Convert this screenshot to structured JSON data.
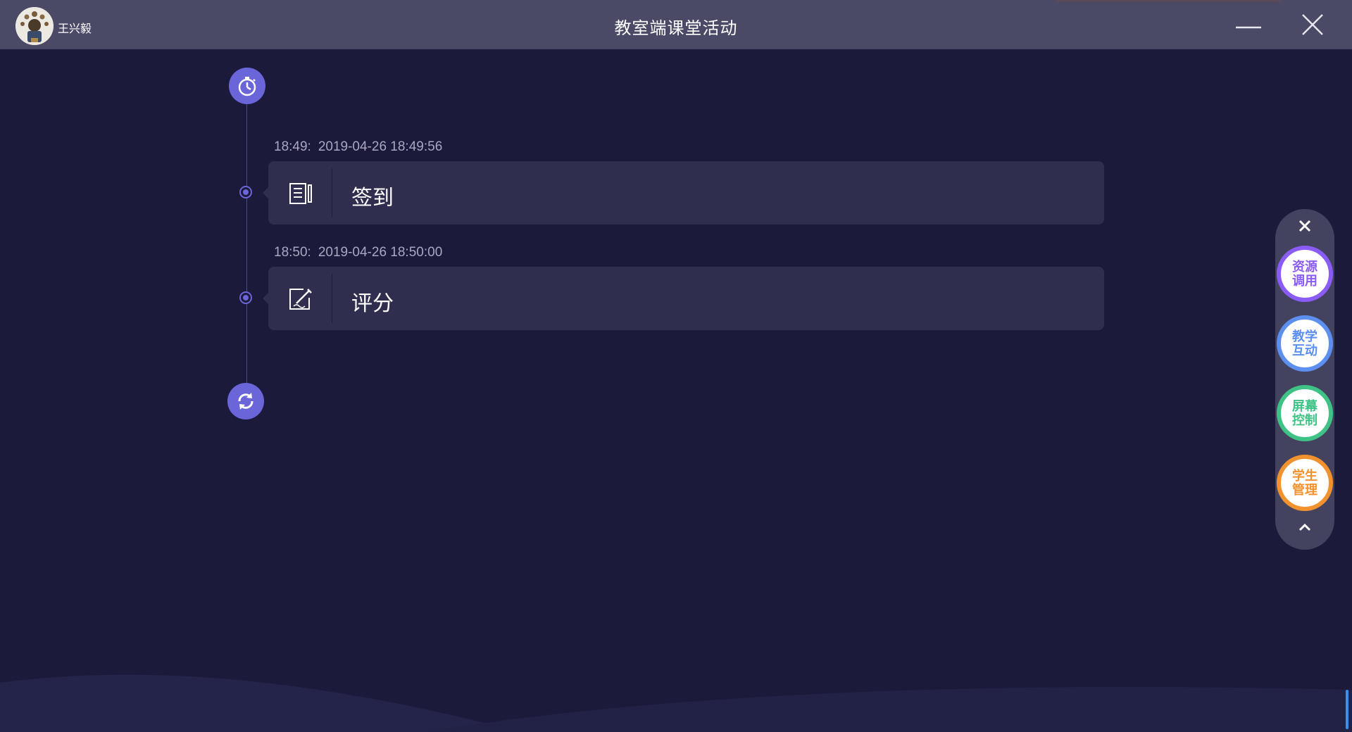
{
  "window": {
    "title": "教室端课堂活动",
    "username": "王兴毅"
  },
  "timeline": {
    "entries": [
      {
        "time": "18:49:",
        "datetime": "2019-04-26 18:49:56",
        "label": "签到",
        "icon": "sign-in-document-icon"
      },
      {
        "time": "18:50:",
        "datetime": "2019-04-26 18:50:00",
        "label": "评分",
        "icon": "grading-edit-icon"
      }
    ]
  },
  "side_menu": {
    "items": [
      {
        "line1": "资源",
        "line2": "调用",
        "color": "#8a5cf5"
      },
      {
        "line1": "教学",
        "line2": "互动",
        "color": "#5c8ff0"
      },
      {
        "line1": "屏幕",
        "line2": "控制",
        "color": "#3fc286"
      },
      {
        "line1": "学生",
        "line2": "管理",
        "color": "#f2922f"
      }
    ]
  },
  "colors": {
    "background": "#1b1a3b",
    "titlebar": "#4a4966",
    "card": "#302e4f",
    "timeline_accent": "#6a65d8"
  }
}
